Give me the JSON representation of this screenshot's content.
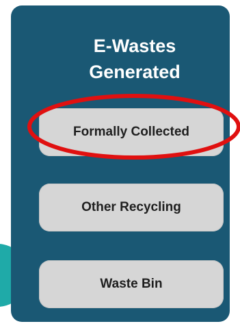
{
  "diagram": {
    "title_line1": "E-Wastes",
    "title_line2": "Generated",
    "items": [
      {
        "label": "Formally Collected",
        "highlighted": true
      },
      {
        "label": "Other Recycling",
        "highlighted": false
      },
      {
        "label": "Waste Bin",
        "highlighted": false
      }
    ]
  },
  "colors": {
    "panel": "#1a5874",
    "box": "#d6d6d6",
    "highlight_ellipse": "#e01010",
    "arrow": "#1faaa8",
    "title_text": "#ffffff",
    "box_text": "#1f1f1f"
  }
}
